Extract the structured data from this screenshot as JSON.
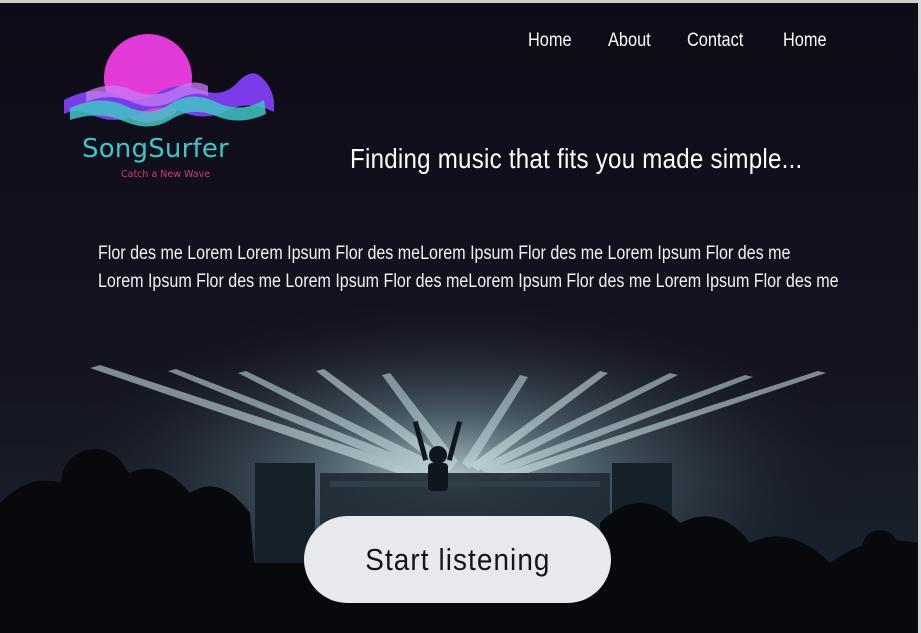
{
  "brand": {
    "name": "SongSurfer",
    "tagline": "Catch a New Wave",
    "colors": {
      "wordmark": "#3cc7c7",
      "tagline": "#d4397d",
      "logo_magenta": "#e23ad6",
      "logo_purple": "#7a3be8",
      "logo_teal": "#3fc6c6"
    }
  },
  "nav": {
    "items": [
      {
        "label": "Home"
      },
      {
        "label": "About"
      },
      {
        "label": "Contact"
      },
      {
        "label": "Home"
      }
    ]
  },
  "hero": {
    "headline": "Finding music that fits you made simple...",
    "body_lines": [
      "Flor des me Lorem Lorem Ipsum Flor des meLorem Ipsum Flor des me Lorem Ipsum Flor des me",
      "Lorem Ipsum Flor des me Lorem Ipsum Flor des meLorem Ipsum Flor des me Lorem Ipsum Flor des me"
    ],
    "cta_label": "Start listening",
    "background": "concert-stage-photo"
  }
}
